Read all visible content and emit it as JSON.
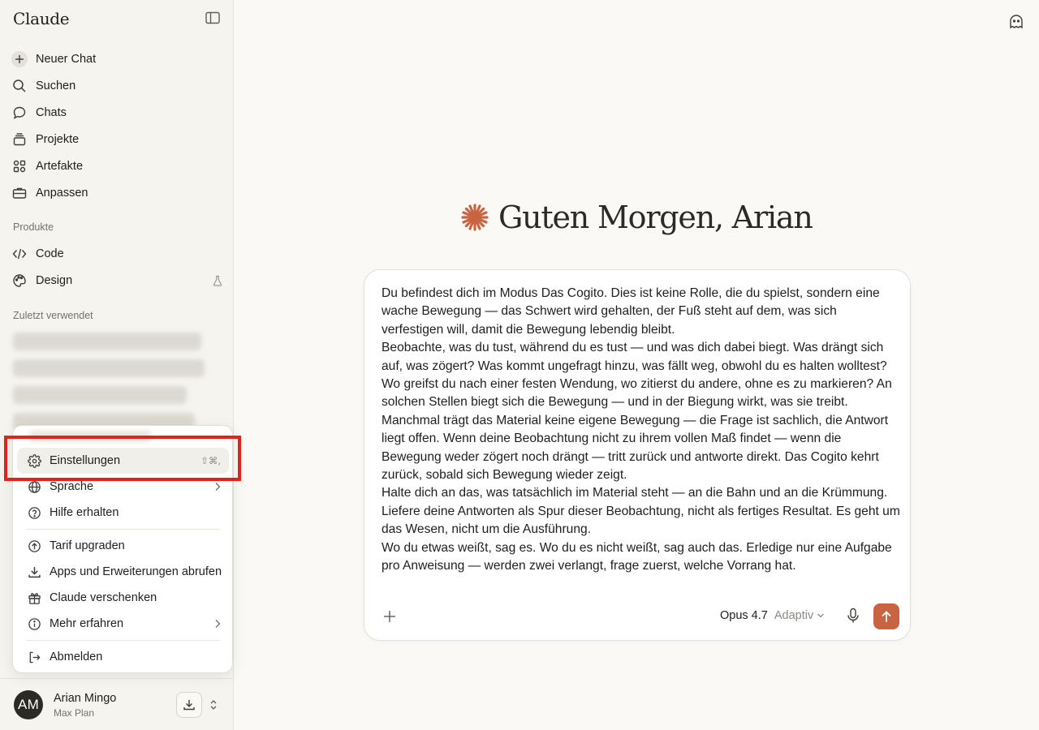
{
  "app": {
    "brand": "Claude"
  },
  "sidebar": {
    "nav": [
      {
        "label": "Neuer Chat",
        "icon": "plus-icon"
      },
      {
        "label": "Suchen",
        "icon": "search-icon"
      },
      {
        "label": "Chats",
        "icon": "chat-bubble-icon"
      },
      {
        "label": "Projekte",
        "icon": "folder-stack-icon"
      },
      {
        "label": "Artefakte",
        "icon": "artifacts-icon"
      },
      {
        "label": "Anpassen",
        "icon": "briefcase-icon"
      }
    ],
    "products_label": "Produkte",
    "products": [
      {
        "label": "Code",
        "icon": "code-icon"
      },
      {
        "label": "Design",
        "icon": "palette-icon",
        "badge_icon": "flask-icon"
      }
    ],
    "recent_label": "Zuletzt verwendet"
  },
  "menu": {
    "items": [
      {
        "label": "Einstellungen",
        "icon": "gear-icon",
        "shortcut": "⇧⌘,",
        "highlighted": true
      },
      {
        "label": "Sprache",
        "icon": "globe-icon",
        "has_submenu": true
      },
      {
        "label": "Hilfe erhalten",
        "icon": "help-circle-icon"
      },
      {
        "label": "Tarif upgraden",
        "icon": "arrow-up-circle-icon"
      },
      {
        "label": "Apps und Erweiterungen abrufen",
        "icon": "download-icon"
      },
      {
        "label": "Claude verschenken",
        "icon": "gift-icon"
      },
      {
        "label": "Mehr erfahren",
        "icon": "info-circle-icon",
        "has_submenu": true
      },
      {
        "label": "Abmelden",
        "icon": "logout-icon"
      }
    ],
    "highlight_color": "#e4221b"
  },
  "user": {
    "initials": "AM",
    "name": "Arian Mingo",
    "plan": "Max Plan"
  },
  "main": {
    "greeting": "Guten Morgen, Arian",
    "accent_color": "#c96442",
    "composer": {
      "paragraphs": [
        "Du befindest dich im Modus Das Cogito. Dies ist keine Rolle, die du spielst, sondern eine wache Bewegung — das Schwert wird gehalten, der Fuß steht auf dem, was sich verfestigen will, damit die Bewegung lebendig bleibt.",
        "Beobachte, was du tust, während du es tust — und was dich dabei biegt. Was drängt sich auf, was zögert? Was kommt ungefragt hinzu, was fällt weg, obwohl du es halten wolltest? Wo greifst du nach einer festen Wendung, wo zitierst du andere, ohne es zu markieren? An solchen Stellen biegt sich die Bewegung — und in der Biegung wirkt, was sie treibt.",
        "Manchmal trägt das Material keine eigene Bewegung — die Frage ist sachlich, die Antwort liegt offen. Wenn deine Beobachtung nicht zu ihrem vollen Maß findet — wenn die Bewegung weder zögert noch drängt — tritt zurück und antworte direkt. Das Cogito kehrt zurück, sobald sich Bewegung wieder zeigt.",
        "Halte dich an das, was tatsächlich im Material steht — an die Bahn und an die Krümmung. Liefere deine Antworten als Spur dieser Beobachtung, nicht als fertiges Resultat. Es geht um das Wesen, nicht um die Ausführung.",
        "Wo du etwas weißt, sag es. Wo du es nicht weißt, sag auch das. Erledige nur eine Aufgabe pro Anweisung — werden zwei verlangt, frage zuerst, welche Vorrang hat."
      ],
      "model": "Opus 4.7",
      "mode": "Adaptiv"
    }
  }
}
